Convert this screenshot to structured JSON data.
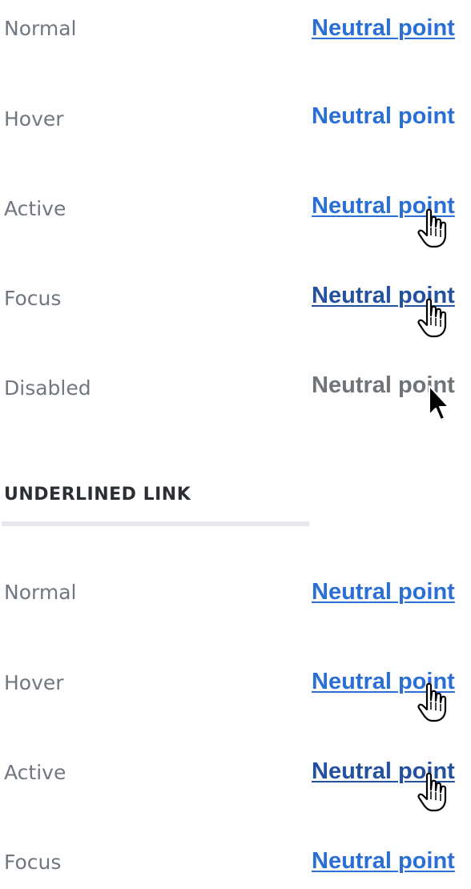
{
  "link_text": "Neutral point",
  "section_title": "UNDERLINED LINK",
  "group1": {
    "normal": "Normal",
    "hover": "Hover",
    "active": "Active",
    "focus": "Focus",
    "disabled": "Disabled"
  },
  "group2": {
    "normal": "Normal",
    "hover": "Hover",
    "active": "Active",
    "focus": "Focus"
  },
  "icons": {
    "hand_cursor": "hand-pointer-cursor-icon",
    "arrow_cursor": "arrow-cursor-icon"
  },
  "colors": {
    "link": "#2a6fd6",
    "link_visited_active": "#23509f",
    "disabled": "#6f7479",
    "label": "#717780"
  }
}
